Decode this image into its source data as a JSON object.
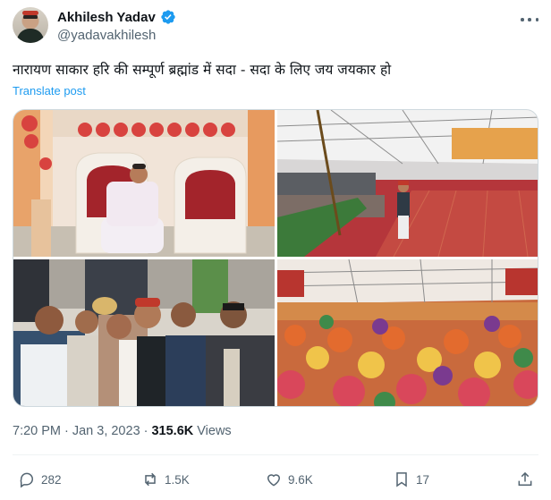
{
  "author": {
    "display_name": "Akhilesh Yadav",
    "handle": "@yadavakhilesh",
    "verified": true,
    "avatar_icon": "avatar-image"
  },
  "post": {
    "text": "नारायण साकार हरि की सम्पूर्ण ब्रह्मांड में सदा - सदा के लिए जय जयकार हो",
    "translate_label": "Translate post"
  },
  "media": {
    "images": [
      {
        "name": "photo-stage-chairs"
      },
      {
        "name": "photo-speaker-tent"
      },
      {
        "name": "photo-audience-front-row"
      },
      {
        "name": "photo-large-crowd"
      }
    ]
  },
  "meta": {
    "time": "7:20 PM",
    "separator": "·",
    "date": "Jan 3, 2023",
    "separator2": "·",
    "views_count": "315.6K",
    "views_label": "Views"
  },
  "actions": {
    "replies": "282",
    "reposts": "1.5K",
    "likes": "9.6K",
    "bookmarks": "17"
  },
  "colors": {
    "accent": "#1d9bf0",
    "secondary_text": "#536471",
    "primary_text": "#0f1419"
  }
}
